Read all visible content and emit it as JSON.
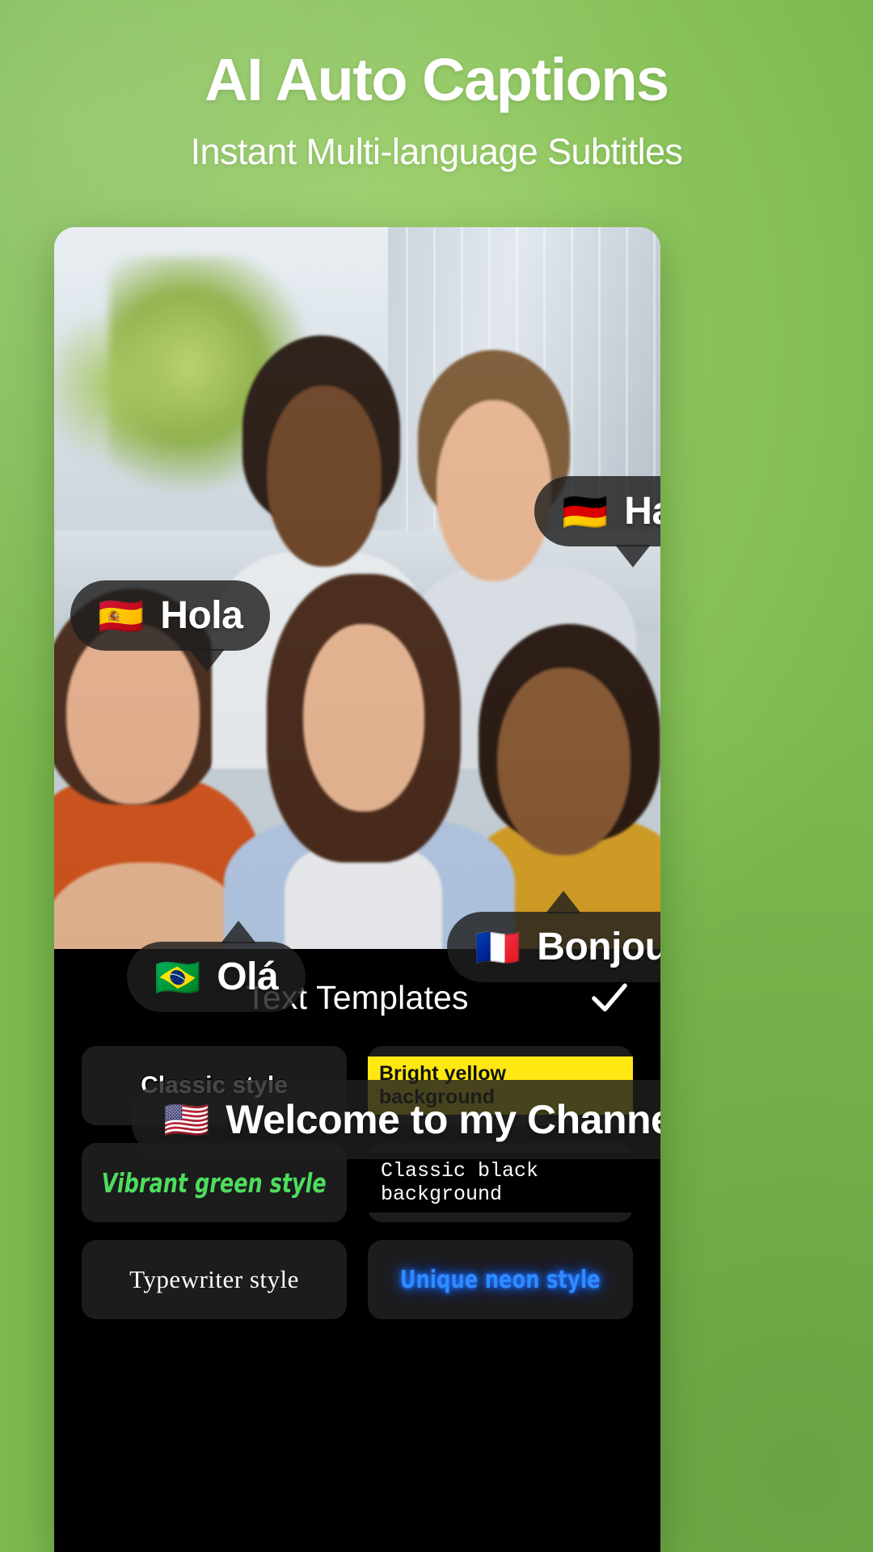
{
  "header": {
    "title": "AI Auto Captions",
    "subtitle": "Instant Multi-language Subtitles"
  },
  "colors": {
    "background_green": "#8cc152",
    "panel_black": "#000000",
    "card_dark": "#1c1c1c",
    "bubble_dark": "rgba(30,30,30,0.82)",
    "accent_yellow": "#ffe812",
    "accent_green": "#4ddd5d",
    "accent_neon_blue": "#2f8bff",
    "text_white": "#ffffff"
  },
  "preview": {
    "captions": [
      {
        "id": "hallo",
        "flag": "🇩🇪",
        "flag_name": "germany-flag",
        "text": "Hallo",
        "language": "German"
      },
      {
        "id": "hola",
        "flag": "🇪🇸",
        "flag_name": "spain-flag",
        "text": "Hola",
        "language": "Spanish"
      },
      {
        "id": "ola",
        "flag": "🇧🇷",
        "flag_name": "brazil-flag",
        "text": "Olá",
        "language": "Portuguese"
      },
      {
        "id": "bonjour",
        "flag": "🇫🇷",
        "flag_name": "france-flag",
        "text": "Bonjour",
        "language": "French"
      },
      {
        "id": "welcome",
        "flag": "🇺🇸",
        "flag_name": "usa-flag",
        "text": "Welcome to my Channel",
        "language": "English"
      }
    ]
  },
  "templates_panel": {
    "title": "Text Templates",
    "confirm_icon": "check-icon",
    "items": [
      {
        "id": "classic",
        "label": "Classic style"
      },
      {
        "id": "yellow",
        "label": "Bright yellow background"
      },
      {
        "id": "green",
        "label": "Vibrant green style"
      },
      {
        "id": "black",
        "label": "Classic black background"
      },
      {
        "id": "typewriter",
        "label": "Typewriter style"
      },
      {
        "id": "neon",
        "label": "Unique neon style"
      }
    ]
  }
}
